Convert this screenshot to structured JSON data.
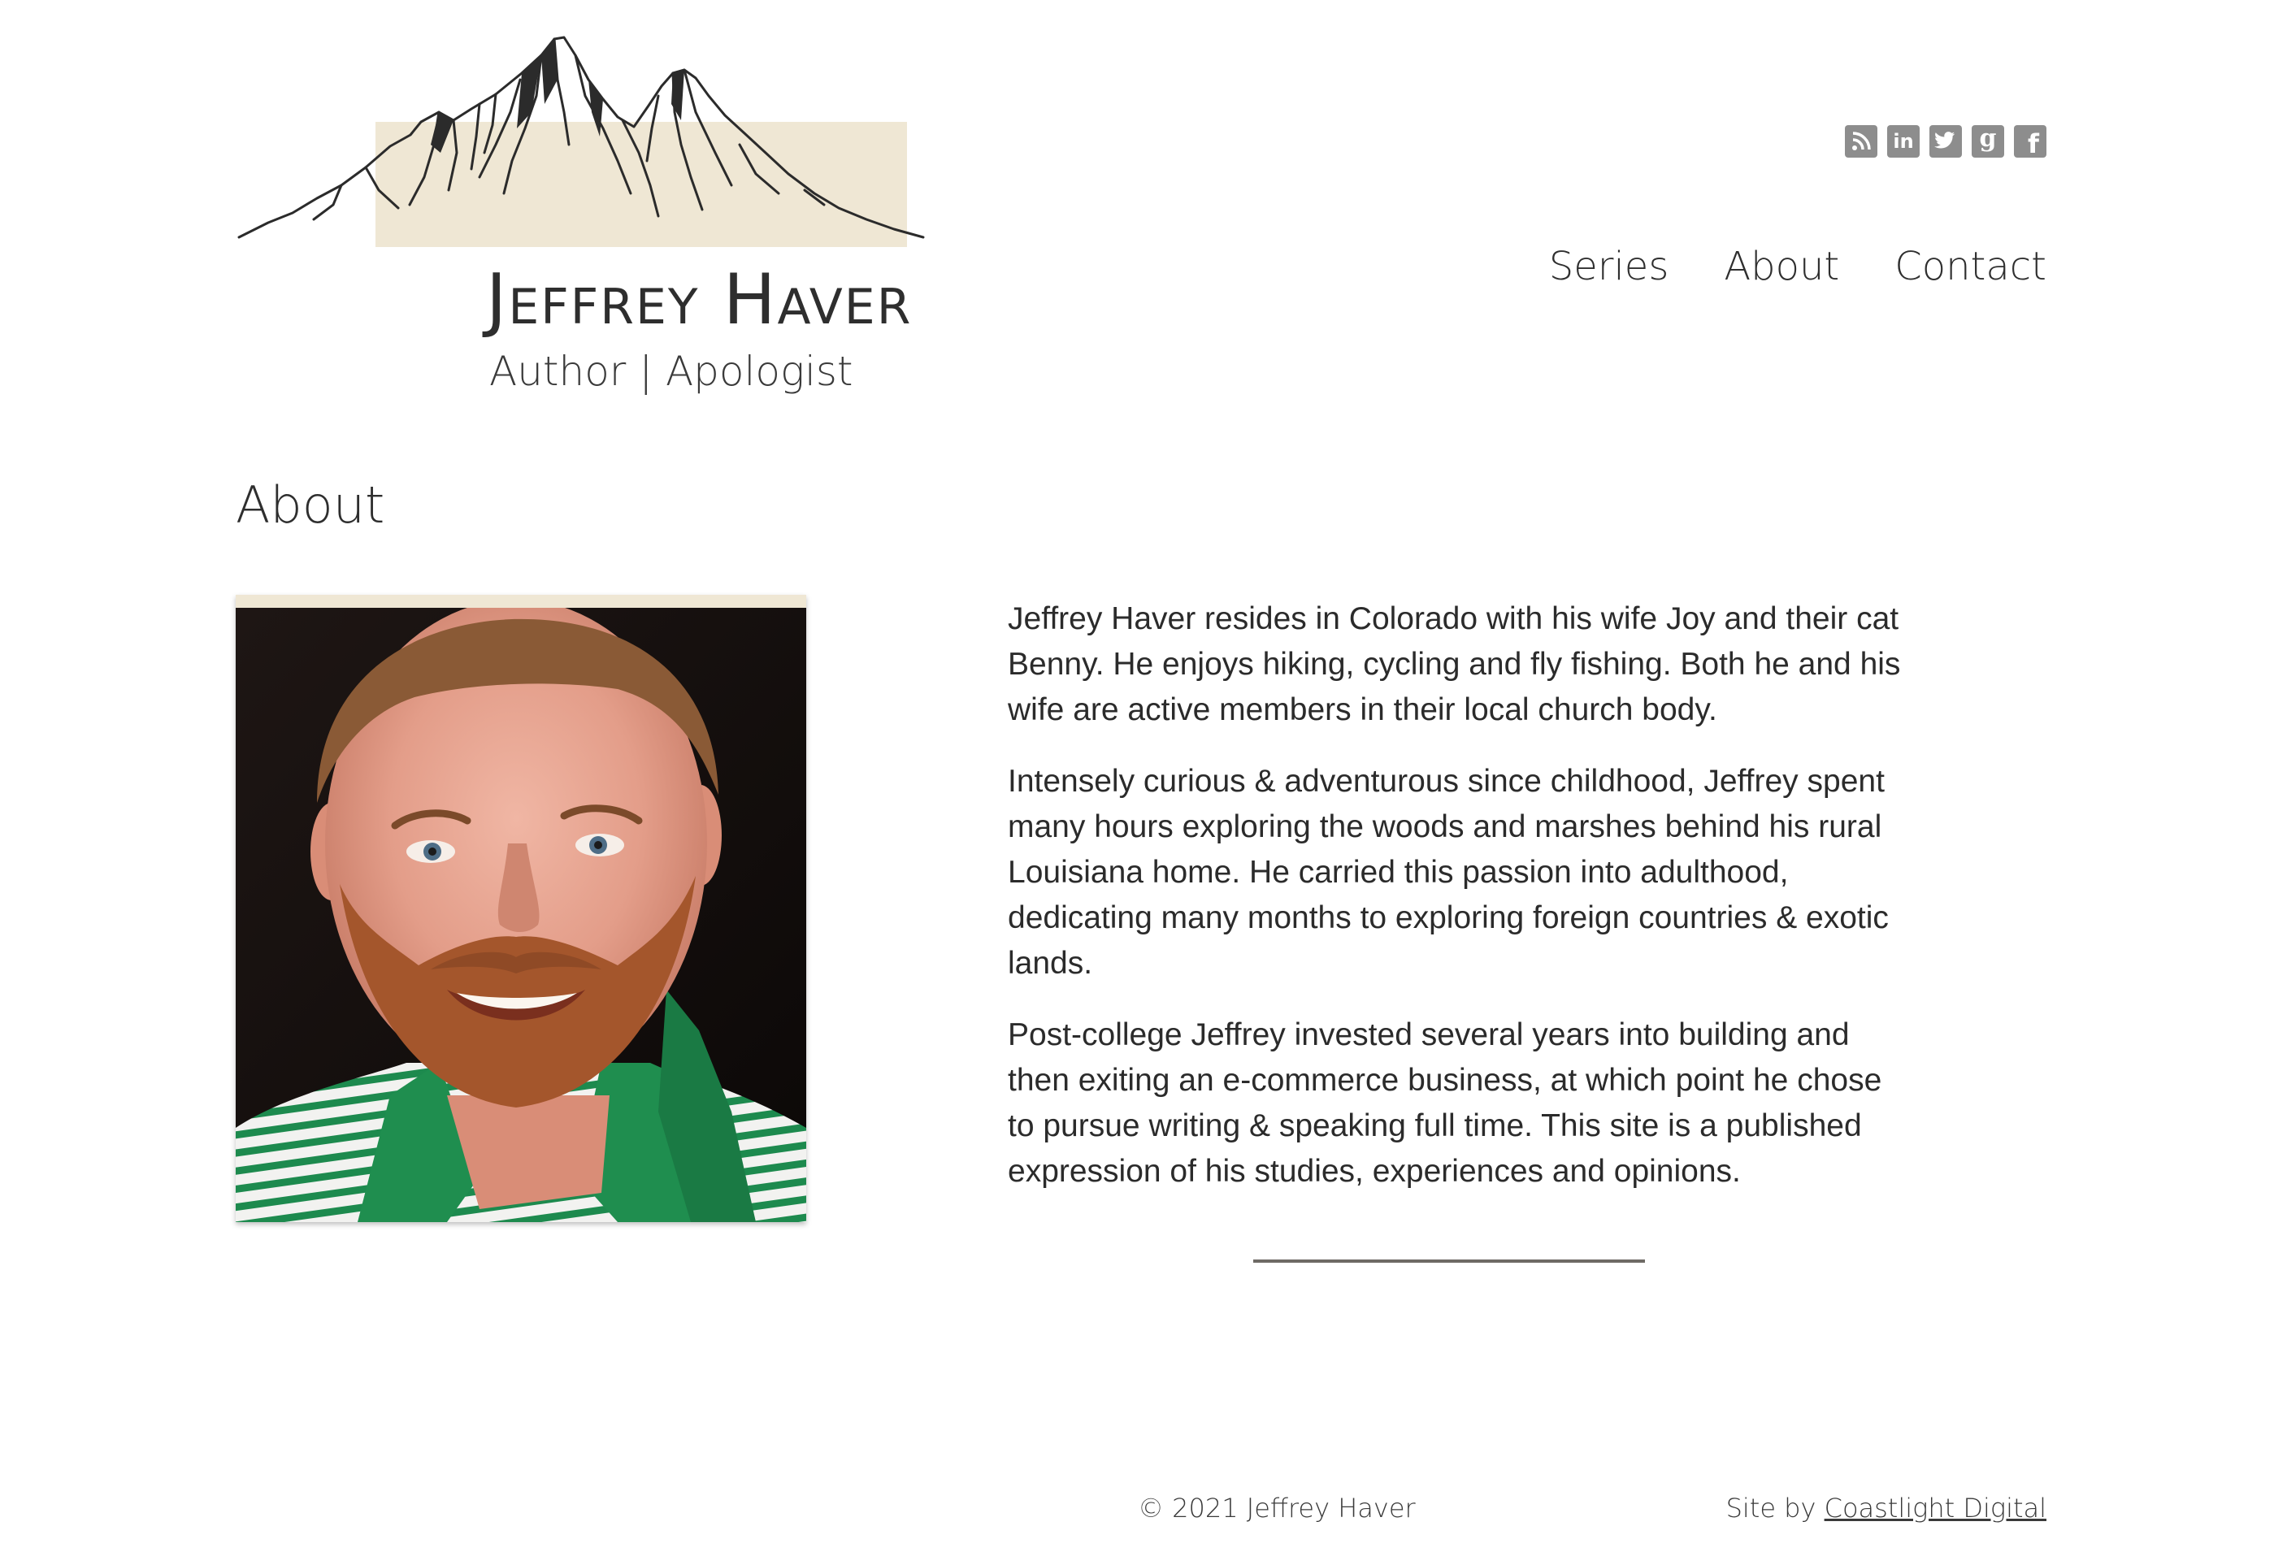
{
  "header": {
    "site_title": "Jeffrey Haver",
    "tagline": "Author | Apologist",
    "logo_icon": "mountain-sketch-logo",
    "accent_color": "#efe7d4"
  },
  "social": {
    "icons": [
      {
        "name": "rss-icon"
      },
      {
        "name": "linkedin-icon",
        "glyph": "in"
      },
      {
        "name": "twitter-icon"
      },
      {
        "name": "goodreads-icon",
        "glyph": "g"
      },
      {
        "name": "facebook-icon",
        "glyph": "f"
      }
    ],
    "icon_color": "#8d8d8d"
  },
  "nav": {
    "items": [
      {
        "label": "Series",
        "active": false
      },
      {
        "label": "About",
        "active": true
      },
      {
        "label": "Contact",
        "active": false
      }
    ]
  },
  "main": {
    "heading": "About",
    "photo_alt": "Portrait of Jeffrey Haver",
    "paragraphs": [
      "Jeffrey Haver resides in Colorado with his wife Joy and their cat Benny. He enjoys hiking, cycling and fly fishing. Both he and his wife are active members in their local church body.",
      "Intensely curious & adventurous since childhood, Jeffrey spent many hours exploring the woods and marshes behind his rural Louisiana home. He carried this passion into adulthood, dedicating many months to exploring foreign countries & exotic lands.",
      "Post-college Jeffrey invested several years into building and then exiting an e-commerce business, at which point he chose to pursue writing & speaking full time. This site is a published expression of his studies, experiences and opinions."
    ]
  },
  "footer": {
    "copyright": "© 2021 Jeffrey Haver",
    "credit_prefix": "Site by",
    "credit_link": "Coastlight Digital"
  }
}
